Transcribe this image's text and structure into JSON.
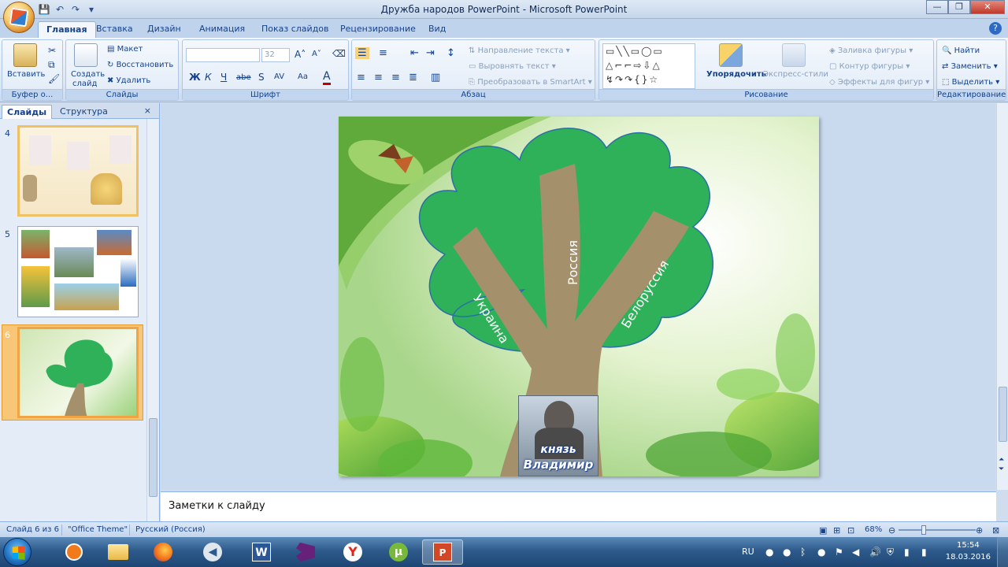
{
  "window": {
    "title": "Дружба народов PowerPoint - Microsoft PowerPoint"
  },
  "tabs": [
    "Главная",
    "Вставка",
    "Дизайн",
    "Анимация",
    "Показ слайдов",
    "Рецензирование",
    "Вид"
  ],
  "ribbon": {
    "clipboard": {
      "paste": "Вставить",
      "label": "Буфер о..."
    },
    "slides": {
      "new_slide_1": "Создать",
      "new_slide_2": "слайд",
      "layout": "Макет",
      "reset": "Восстановить",
      "delete": "Удалить",
      "label": "Слайды"
    },
    "font": {
      "size": "32",
      "label": "Шрифт",
      "bold": "Ж",
      "italic": "К",
      "underline": "Ч",
      "strike": "abe",
      "shadow": "S",
      "spacing": "AV",
      "case": "Aa"
    },
    "paragraph": {
      "direction": "Направление текста",
      "align": "Выровнять текст",
      "smartart": "Преобразовать в SmartArt",
      "label": "Абзац"
    },
    "drawing": {
      "arrange": "Упорядочить",
      "quick_styles": "Экспресс-стили",
      "fill": "Заливка фигуры",
      "outline": "Контур фигуры",
      "effects": "Эффекты для фигур",
      "label": "Рисование"
    },
    "editing": {
      "find": "Найти",
      "replace": "Заменить",
      "select": "Выделить",
      "label": "Редактирование"
    }
  },
  "left_pane": {
    "tab_slides": "Слайды",
    "tab_outline": "Структура",
    "close": "×",
    "thumbnails": [
      {
        "num": "4"
      },
      {
        "num": "5"
      },
      {
        "num": "6"
      }
    ]
  },
  "slide": {
    "branch_left": "Украина",
    "branch_middle": "Россия",
    "branch_right": "Белоруссия",
    "badge_line1": "князь",
    "badge_line2": "Владимир"
  },
  "notes": {
    "placeholder": "Заметки к слайду"
  },
  "statusbar": {
    "slide_count": "Слайд 6 из 6",
    "theme": "\"Office Theme\"",
    "language": "Русский (Россия)",
    "zoom": "68%"
  },
  "taskbar": {
    "lang": "RU",
    "time": "15:54",
    "date": "18.03.2016"
  },
  "colors": {
    "tree_green": "#2fb15a",
    "trunk": "#a4906a",
    "ribbon_bg": "#dbe7f6",
    "selection_orange": "#f0a443"
  }
}
